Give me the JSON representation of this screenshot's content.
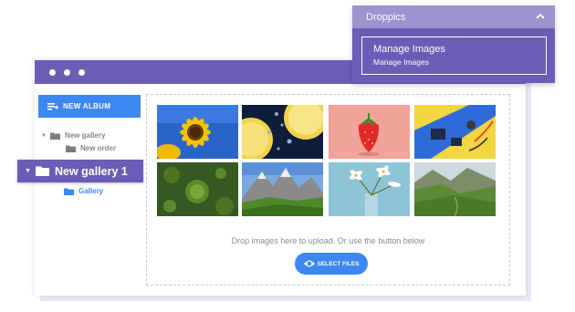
{
  "popup": {
    "title": "Droppics",
    "item_title": "Manage Images",
    "item_subtitle": "Manage Images"
  },
  "sidebar": {
    "new_album_label": "NEW ALBUM",
    "tree": [
      {
        "label": "New gallery"
      },
      {
        "label": "New order"
      },
      {
        "label": "New gallery 1"
      },
      {
        "label": "Gallery"
      }
    ]
  },
  "dropzone": {
    "hint": "Drop images here to upload. Or use the button below",
    "select_label": "SELECT FILES",
    "images": [
      {
        "subject": "sunflower"
      },
      {
        "subject": "lemon slices"
      },
      {
        "subject": "strawberry"
      },
      {
        "subject": "electronics"
      },
      {
        "subject": "tree forest"
      },
      {
        "subject": "mountains"
      },
      {
        "subject": "white flowers"
      },
      {
        "subject": "green valley"
      }
    ]
  },
  "colors": {
    "accent_purple": "#6a5db5",
    "header_lavender": "#9b94cf",
    "button_blue": "#3d87f0"
  }
}
